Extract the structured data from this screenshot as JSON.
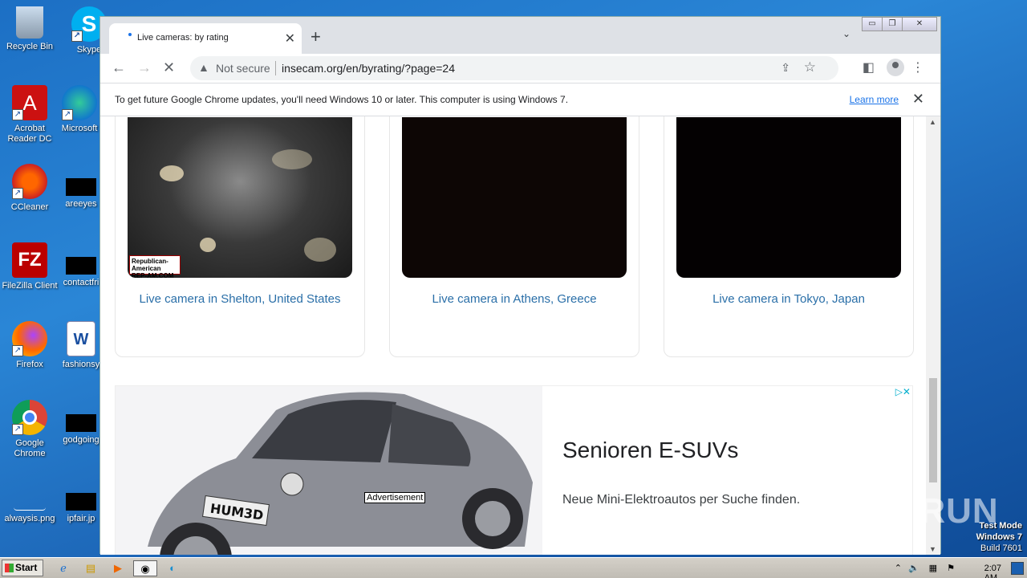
{
  "desktop": {
    "icons": [
      {
        "label": "Recycle Bin"
      },
      {
        "label": "Skype"
      },
      {
        "label": "Acrobat Reader DC"
      },
      {
        "label": "Microsoft"
      },
      {
        "label": "CCleaner"
      },
      {
        "label": "areeyes"
      },
      {
        "label": "FileZilla Client"
      },
      {
        "label": "contactfri"
      },
      {
        "label": "Firefox"
      },
      {
        "label": "fashionsy"
      },
      {
        "label": "Google Chrome"
      },
      {
        "label": "godgoing"
      },
      {
        "label": "alwaysis.png"
      },
      {
        "label": "ipfair.jp"
      }
    ]
  },
  "browser": {
    "tab_title": "Live cameras: by rating",
    "tab_close": "✕",
    "new_tab": "+",
    "omnibox": {
      "warning": "Not secure",
      "url": "insecam.org/en/byrating/?page=24"
    },
    "infobar": {
      "message": "To get future Google Chrome updates, you'll need Windows 10 or later. This computer is using Windows 7.",
      "link": "Learn more"
    }
  },
  "page": {
    "cameras": [
      {
        "caption": "Live camera in Shelton, United States",
        "logo_text": "Republican-American REP-AM.COM"
      },
      {
        "caption": "Live camera in Athens, Greece"
      },
      {
        "caption": "Live camera in Tokyo, Japan"
      }
    ],
    "ad": {
      "headline": "Senioren E-SUVs",
      "description": "Neue Mini-Elektroautos per Suche finden.",
      "tag": "Advertisement",
      "plate": "HUM3D"
    }
  },
  "watermark": "ANY RUN",
  "test_mode": {
    "line1": "Test Mode",
    "line2": "Windows 7",
    "line3": "Build 7601"
  },
  "taskbar": {
    "start_label": "Start",
    "clock": "2:07 AM"
  }
}
